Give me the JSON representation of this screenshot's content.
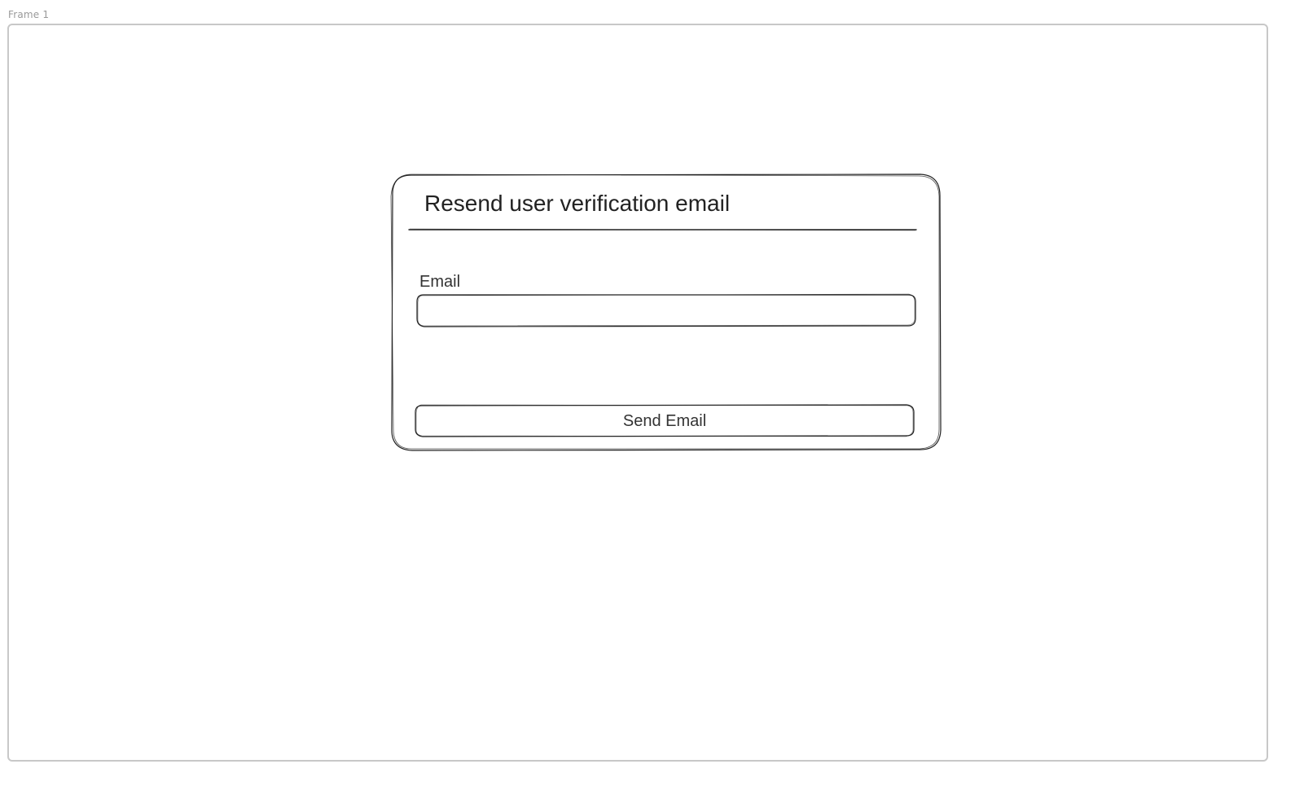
{
  "canvas": {
    "frame_label": "Frame 1"
  },
  "dialog": {
    "title": "Resend user verification email",
    "email": {
      "label": "Email",
      "value": "",
      "placeholder": ""
    },
    "send_button_label": "Send Email"
  },
  "colors": {
    "stroke": "#222222",
    "frame_border": "#c8c8c8",
    "frame_label": "#9a9a9a"
  }
}
